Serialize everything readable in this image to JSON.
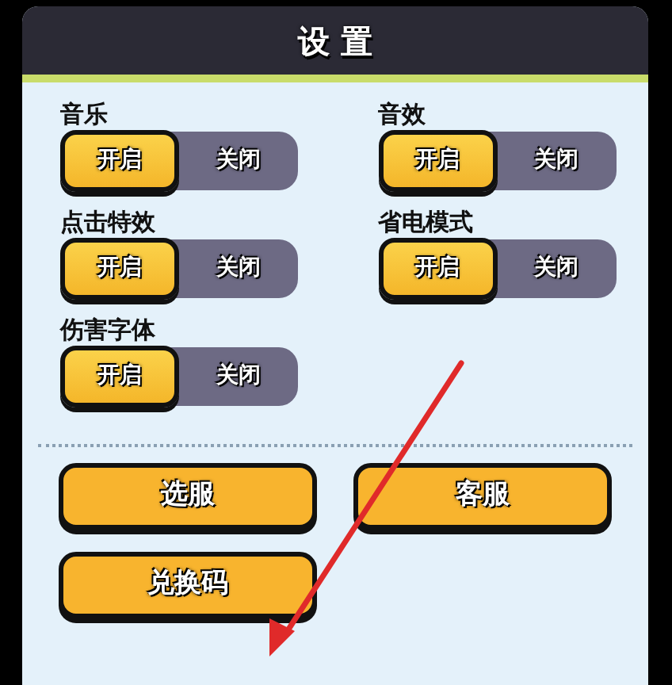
{
  "window": {
    "title": "设 置"
  },
  "settings": [
    {
      "label": "音乐",
      "on_text": "开启",
      "off_text": "关闭",
      "on": true
    },
    {
      "label": "音效",
      "on_text": "开启",
      "off_text": "关闭",
      "on": true
    },
    {
      "label": "点击特效",
      "on_text": "开启",
      "off_text": "关闭",
      "on": true
    },
    {
      "label": "省电模式",
      "on_text": "开启",
      "off_text": "关闭",
      "on": true
    },
    {
      "label": "伤害字体",
      "on_text": "开启",
      "off_text": "关闭",
      "on": true
    }
  ],
  "buttons": [
    "选服",
    "客服",
    "兑换码"
  ]
}
